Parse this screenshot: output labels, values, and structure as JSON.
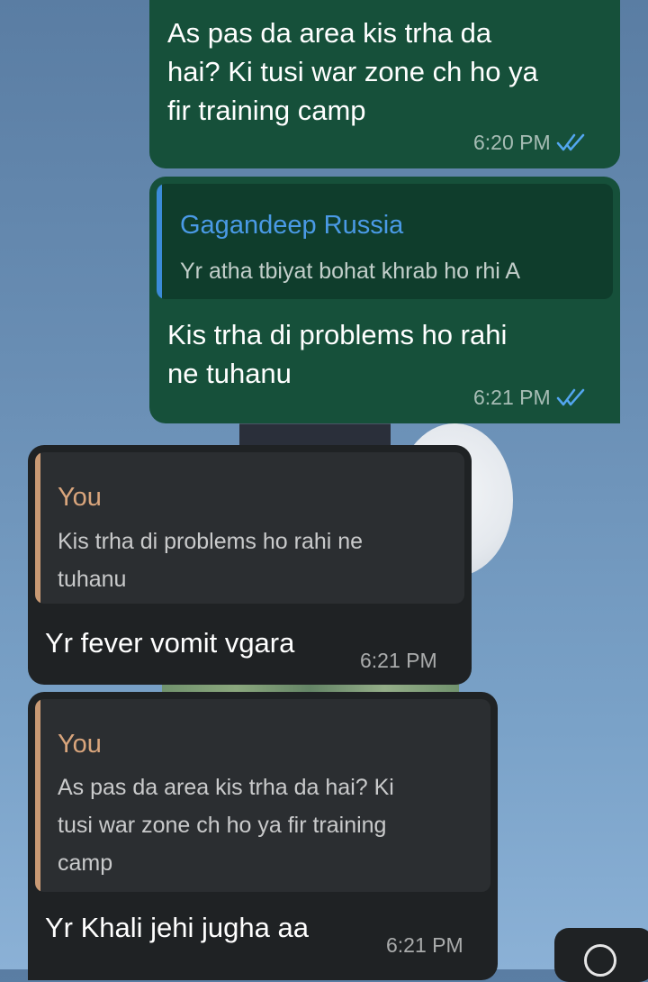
{
  "messages": [
    {
      "direction": "outgoing",
      "text": "As pas da area kis trha da hai? Ki tusi war zone ch ho ya fir training camp",
      "lines": [
        "As pas da area kis trha da",
        "hai? Ki tusi war zone ch ho ya",
        "fir training camp"
      ],
      "time": "6:20 PM",
      "status": "read"
    },
    {
      "direction": "outgoing",
      "reply_to": {
        "name": "Gagandeep Russia",
        "text": "Yr atha tbiyat bohat khrab ho rhi A"
      },
      "text": "Kis trha di problems ho rahi ne tuhanu",
      "lines": [
        "Kis trha di problems ho rahi",
        "ne tuhanu"
      ],
      "time": "6:21 PM",
      "status": "read"
    },
    {
      "direction": "incoming",
      "reply_to": {
        "name": "You",
        "text": "Kis trha di problems ho rahi ne tuhanu",
        "lines": [
          "Kis trha di problems ho rahi ne",
          "tuhanu"
        ]
      },
      "text": "Yr fever vomit vgara",
      "time": "6:21 PM"
    },
    {
      "direction": "incoming",
      "reply_to": {
        "name": "You",
        "text": "As pas da area kis trha da hai? Ki tusi war zone ch ho ya fir training camp",
        "lines": [
          "As pas da area kis trha da hai? Ki",
          "tusi war zone ch ho ya fir training",
          "camp"
        ]
      },
      "text": "Yr Khali jehi jugha aa",
      "time": "6:21 PM"
    }
  ],
  "colors": {
    "outgoing_bubble": "#16503a",
    "incoming_bubble": "#1f2224",
    "quote_out_bar": "#3b8bd9",
    "quote_in_bar": "#c99a74",
    "read_ticks": "#53a6f0"
  },
  "icons": {
    "read_receipt": "double-check-icon",
    "scroll_down": "chevron-down-circle-icon"
  }
}
